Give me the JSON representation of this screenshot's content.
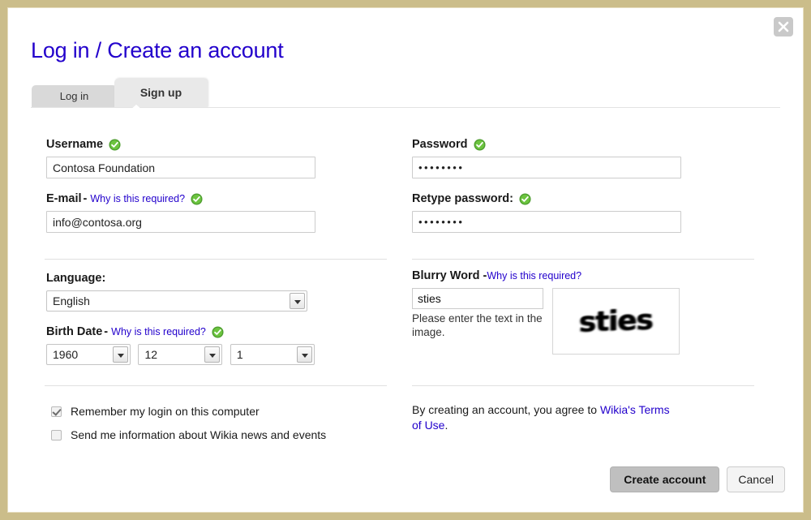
{
  "dialog": {
    "title": "Log in / Create an account",
    "close_icon": "close-icon"
  },
  "tabs": [
    {
      "label": "Log in",
      "active": false
    },
    {
      "label": "Sign up",
      "active": true
    }
  ],
  "form": {
    "username": {
      "label": "Username",
      "value": "Contosa Foundation",
      "valid_icon": "green-check-icon"
    },
    "email": {
      "label": "E-mail",
      "dash": "-",
      "why_link": "Why is this required?",
      "value": "info@contosa.org",
      "valid_icon": "green-check-icon"
    },
    "password": {
      "label": "Password",
      "value": "••••••••",
      "valid_icon": "green-check-icon"
    },
    "retype_password": {
      "label": "Retype password:",
      "value": "••••••••",
      "valid_icon": "green-check-icon"
    },
    "language": {
      "label": "Language:",
      "value": "English"
    },
    "birth_date": {
      "label": "Birth Date",
      "dash": "-",
      "why_link": "Why is this required?",
      "valid_icon": "green-check-icon",
      "year": "1960",
      "month": "12",
      "day": "1"
    },
    "blurry_word": {
      "label": "Blurry Word",
      "dash": "-",
      "why_link": "Why is this required?",
      "value": "sties",
      "hint": "Please enter the text in the image.",
      "captcha_text": "sties"
    }
  },
  "checkboxes": [
    {
      "label": "Remember my login on this computer",
      "checked": true
    },
    {
      "label": "Send me information about Wikia news and events",
      "checked": false
    }
  ],
  "terms": {
    "prefix": "By creating an account, you agree to ",
    "link1": "Wikia's",
    "link2": "Terms of Use",
    "suffix": "."
  },
  "buttons": {
    "create": "Create account",
    "cancel": "Cancel"
  },
  "colors": {
    "frame": "#cbbd8a",
    "link": "#2200cc",
    "valid": "#55aa33",
    "tab_active": "#e9e9e9",
    "tab_inactive": "#d9d9d9",
    "primary_button": "#bfbfbf"
  }
}
